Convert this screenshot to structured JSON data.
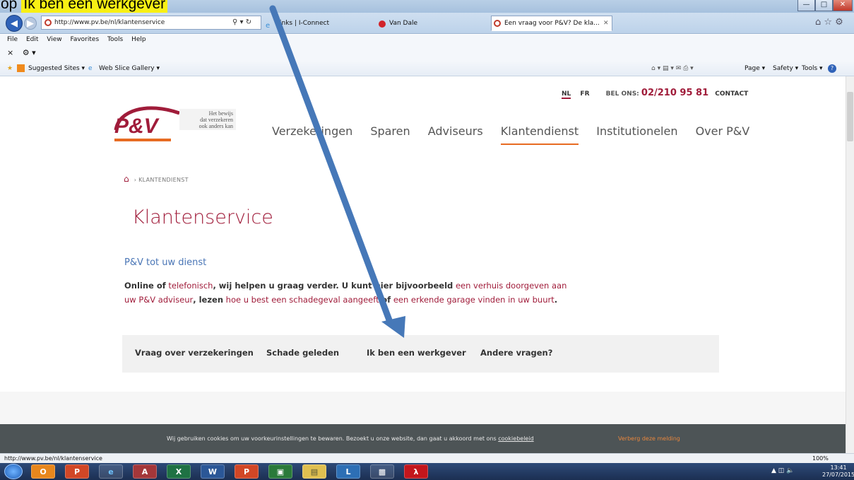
{
  "window": {
    "caption_prefix": "op",
    "caption_highlight": "Ik ben een werkgever"
  },
  "browser": {
    "address": "http://www.pv.be/nl/klantenservice",
    "tabs": [
      {
        "label": "Links | I-Connect"
      },
      {
        "label": "Van Dale"
      },
      {
        "label": "Een vraag voor P&V? De kla..."
      }
    ],
    "menu": [
      "File",
      "Edit",
      "View",
      "Favorites",
      "Tools",
      "Help"
    ],
    "favorites": {
      "suggested": "Suggested Sites ▾",
      "webslice": "Web Slice Gallery ▾"
    },
    "commandbar": {
      "page": "Page ▾",
      "safety": "Safety ▾",
      "tools": "Tools ▾"
    },
    "status_url": "http://www.pv.be/nl/klantenservice",
    "zoom": "100%"
  },
  "site": {
    "lang_nl": "NL",
    "lang_fr": "FR",
    "call_label": "BEL ONS:",
    "phone": "02/210 95 81",
    "contact": "CONTACT",
    "logo_text": "P&V",
    "tagline": [
      "Het bewijs",
      "dat verzekeren",
      "ook anders kan"
    ],
    "nav": [
      "Verzekeringen",
      "Sparen",
      "Adviseurs",
      "Klantendienst",
      "Institutionelen",
      "Over P&V"
    ],
    "breadcrumb": "› KLANTENDIENST",
    "title": "Klantenservice",
    "subheading": "P&V tot uw dienst",
    "para": {
      "p1": "Online of",
      "p2": "telefonisch",
      "p3": ", wij helpen u graag verder. U kunt hier bijvoorbeeld",
      "p4": "een verhuis doorgeven aan uw P&V adviseur",
      "p5": ", lezen",
      "p6": "hoe u best een schadegeval aangeeft",
      "p7": "of",
      "p8": "een erkende garage vinden in uw buurt",
      "p9": "."
    },
    "question_tabs": [
      "Vraag over verzekeringen",
      "Schade geleden",
      "Ik ben een werkgever",
      "Andere vragen?"
    ],
    "cookie_text": "Wij gebruiken cookies om uw voorkeurinstellingen te bewaren. Bezoekt u onze website, dan gaat u akkoord met ons",
    "cookie_link": "cookiebeleid",
    "cookie_hide": "Verberg deze melding"
  },
  "clock": {
    "time": "13:41",
    "date": "27/07/2015"
  },
  "colors": {
    "brand": "#a01c3a",
    "accent": "#e76b22",
    "link_blue": "#4a76b6",
    "arrow": "#4678b8"
  }
}
